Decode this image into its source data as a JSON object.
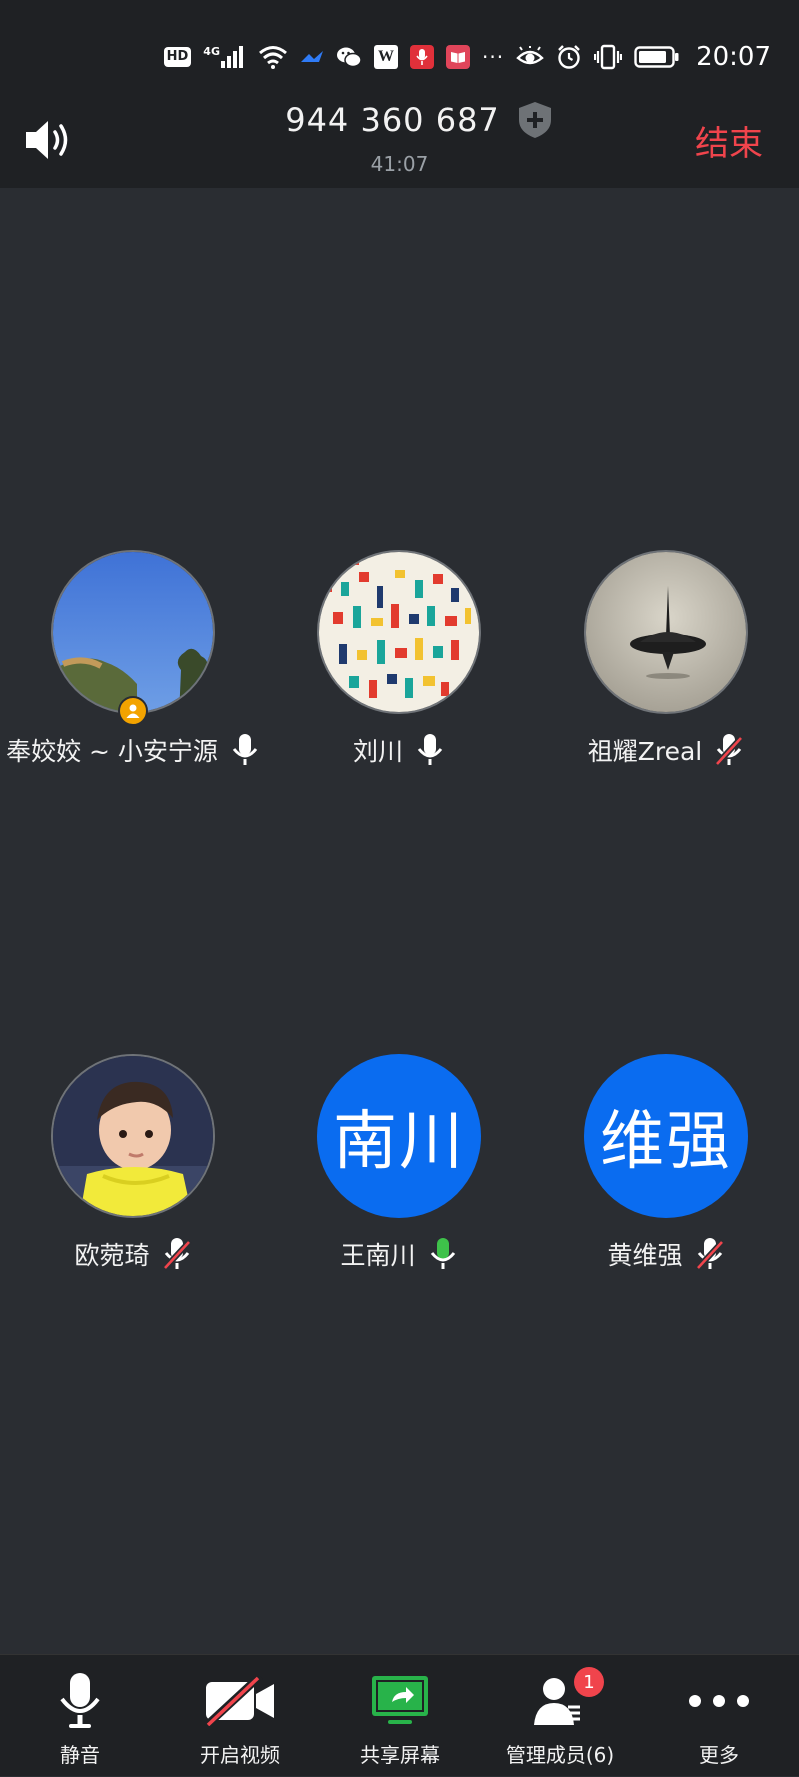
{
  "status_bar": {
    "hd": "HD",
    "network": "4G",
    "wps": "W",
    "time": "20:07",
    "icons": [
      "hd-icon",
      "4g-signal-icon",
      "wifi-icon",
      "feishu-icon",
      "wechat-icon",
      "wps-icon",
      "recorder-icon",
      "book-icon",
      "more-dots-icon",
      "eye-icon",
      "alarm-icon",
      "vibrate-icon",
      "battery-icon"
    ]
  },
  "header": {
    "meeting_id": "944 360 687",
    "elapsed": "41:07",
    "end_label": "结束"
  },
  "participants": [
    {
      "name": "奉姣姣 ~ 小安宁源",
      "mic": "on",
      "avatar": "photo-sky",
      "host": true
    },
    {
      "name": "刘川",
      "mic": "on",
      "avatar": "photo-pattern",
      "host": false
    },
    {
      "name": "祖耀Zreal",
      "mic": "muted",
      "avatar": "photo-spinning-top",
      "host": false
    },
    {
      "name": "欧菀琦",
      "mic": "muted",
      "avatar": "photo-baby",
      "host": false
    },
    {
      "name": "王南川",
      "mic": "speaking",
      "avatar_text": "南川",
      "host": false
    },
    {
      "name": "黄维强",
      "mic": "muted",
      "avatar_text": "维强",
      "host": false
    }
  ],
  "toolbar": {
    "mute_label": "静音",
    "video_label": "开启视频",
    "share_label": "共享屏幕",
    "members_label": "管理成员(6)",
    "members_badge": "1",
    "more_label": "更多"
  },
  "colors": {
    "background": "#2a2d32",
    "bar": "#1f2124",
    "accent_blue": "#0a6cf0",
    "end_red": "#f0444c",
    "speaking_green": "#3ec24a",
    "share_green": "#28b34a",
    "host_orange": "#f3a300"
  }
}
